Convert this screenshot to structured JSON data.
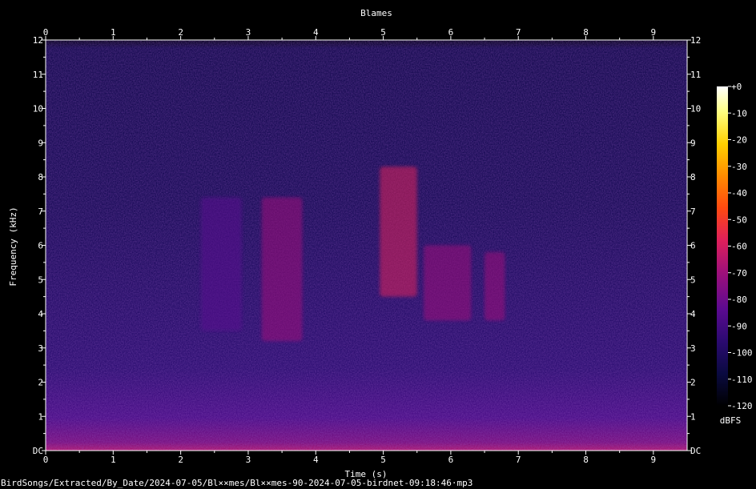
{
  "chart_data": {
    "type": "heatmap",
    "title": "Blames",
    "xlabel": "Time (s)",
    "ylabel": "Frequency (kHz)",
    "xlim": [
      0,
      9.5
    ],
    "ylim": [
      0,
      12
    ],
    "x_ticks": [
      "0",
      "1",
      "2",
      "3",
      "4",
      "5",
      "6",
      "7",
      "8",
      "9"
    ],
    "y_ticks": [
      "DC",
      "1",
      "2",
      "3",
      "4",
      "5",
      "6",
      "7",
      "8",
      "9",
      "10",
      "11",
      "12"
    ],
    "colorbar": {
      "label": "dBFS",
      "ticks": [
        "+0",
        "-10",
        "-20",
        "-30",
        "-40",
        "-50",
        "-60",
        "-70",
        "-80",
        "-90",
        "-100",
        "-110",
        "-120"
      ],
      "range": [
        -120,
        0
      ],
      "colors": [
        "#000000",
        "#0a0a40",
        "#2a0a70",
        "#5a0a90",
        "#a0107a",
        "#e0205a",
        "#ff4a10",
        "#ff8c00",
        "#ffd000",
        "#ffff80",
        "#ffffff"
      ]
    },
    "background_level_dbfs": -95,
    "events": [
      {
        "t_start": 2.3,
        "t_end": 2.9,
        "f_low": 3.5,
        "f_high": 7.4,
        "level_dbfs": -80
      },
      {
        "t_start": 3.2,
        "t_end": 3.8,
        "f_low": 3.2,
        "f_high": 7.4,
        "level_dbfs": -75
      },
      {
        "t_start": 4.95,
        "t_end": 5.5,
        "f_low": 4.5,
        "f_high": 8.3,
        "level_dbfs": -65
      },
      {
        "t_start": 5.6,
        "t_end": 6.3,
        "f_low": 3.8,
        "f_high": 6.0,
        "level_dbfs": -72
      },
      {
        "t_start": 6.5,
        "t_end": 6.8,
        "f_low": 3.8,
        "f_high": 5.8,
        "level_dbfs": -78
      }
    ],
    "footer": "BirdSongs/Extracted/By_Date/2024-07-05/Bl××mes/Bl××mes-90-2024-07-05-birdnet-09:18:46·mp3"
  }
}
